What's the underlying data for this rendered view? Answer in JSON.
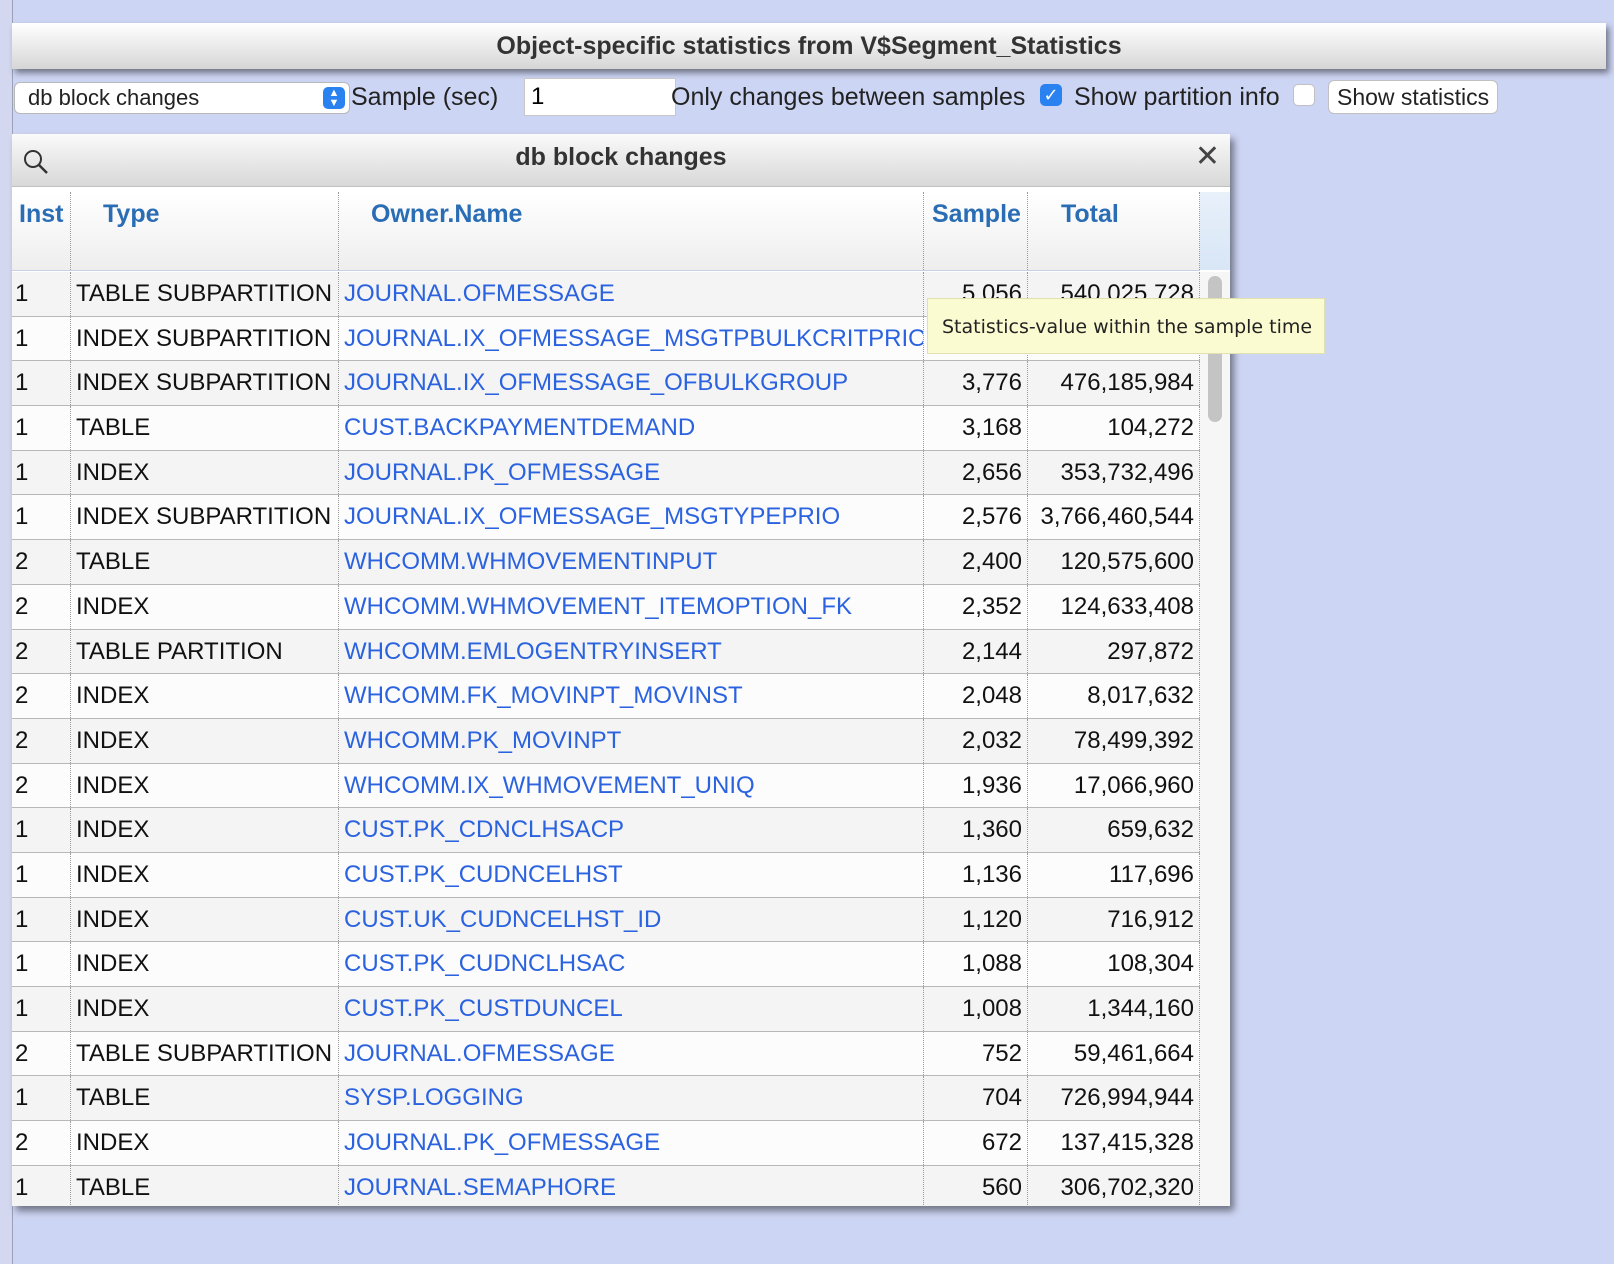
{
  "title": "Object-specific statistics from V$Segment_Statistics",
  "toolbar": {
    "statistic_select": "db block changes",
    "sample_label": "Sample (sec)",
    "sample_value": "1",
    "only_changes_label": "Only changes between samples",
    "only_changes_checked": true,
    "show_partition_label": "Show partition info",
    "show_partition_checked": false,
    "show_statistics_button": "Show statistics"
  },
  "panel": {
    "title": "db block changes",
    "columns": [
      "Inst",
      "Type",
      "Owner.Name",
      "Sample",
      "Total"
    ],
    "rows": [
      [
        "1",
        "TABLE SUBPARTITION",
        "JOURNAL.OFMESSAGE",
        "5,056",
        "540,025,728"
      ],
      [
        "1",
        "INDEX SUBPARTITION",
        "JOURNAL.IX_OFMESSAGE_MSGTPBULKCRITPRIO",
        "",
        ""
      ],
      [
        "1",
        "INDEX SUBPARTITION",
        "JOURNAL.IX_OFMESSAGE_OFBULKGROUP",
        "3,776",
        "476,185,984"
      ],
      [
        "1",
        "TABLE",
        "CUST.BACKPAYMENTDEMAND",
        "3,168",
        "104,272"
      ],
      [
        "1",
        "INDEX",
        "JOURNAL.PK_OFMESSAGE",
        "2,656",
        "353,732,496"
      ],
      [
        "1",
        "INDEX SUBPARTITION",
        "JOURNAL.IX_OFMESSAGE_MSGTYPEPRIO",
        "2,576",
        "3,766,460,544"
      ],
      [
        "2",
        "TABLE",
        "WHCOMM.WHMOVEMENTINPUT",
        "2,400",
        "120,575,600"
      ],
      [
        "2",
        "INDEX",
        "WHCOMM.WHMOVEMENT_ITEMOPTION_FK",
        "2,352",
        "124,633,408"
      ],
      [
        "2",
        "TABLE PARTITION",
        "WHCOMM.EMLOGENTRYINSERT",
        "2,144",
        "297,872"
      ],
      [
        "2",
        "INDEX",
        "WHCOMM.FK_MOVINPT_MOVINST",
        "2,048",
        "8,017,632"
      ],
      [
        "2",
        "INDEX",
        "WHCOMM.PK_MOVINPT",
        "2,032",
        "78,499,392"
      ],
      [
        "2",
        "INDEX",
        "WHCOMM.IX_WHMOVEMENT_UNIQ",
        "1,936",
        "17,066,960"
      ],
      [
        "1",
        "INDEX",
        "CUST.PK_CDNCLHSACP",
        "1,360",
        "659,632"
      ],
      [
        "1",
        "INDEX",
        "CUST.PK_CUDNCELHST",
        "1,136",
        "117,696"
      ],
      [
        "1",
        "INDEX",
        "CUST.UK_CUDNCELHST_ID",
        "1,120",
        "716,912"
      ],
      [
        "1",
        "INDEX",
        "CUST.PK_CUDNCLHSAC",
        "1,088",
        "108,304"
      ],
      [
        "1",
        "INDEX",
        "CUST.PK_CUSTDUNCEL",
        "1,008",
        "1,344,160"
      ],
      [
        "2",
        "TABLE SUBPARTITION",
        "JOURNAL.OFMESSAGE",
        "752",
        "59,461,664"
      ],
      [
        "1",
        "TABLE",
        "SYSP.LOGGING",
        "704",
        "726,994,944"
      ],
      [
        "2",
        "INDEX",
        "JOURNAL.PK_OFMESSAGE",
        "672",
        "137,415,328"
      ],
      [
        "1",
        "TABLE",
        "JOURNAL.SEMAPHORE",
        "560",
        "306,702,320"
      ]
    ]
  },
  "tooltip": "Statistics-value within the sample time",
  "icons": {
    "search": "search-icon",
    "close": "close-icon",
    "select_arrows": "chevron-updown-icon",
    "checkmark": "checkmark-icon"
  },
  "colors": {
    "background": "#cdd5f4",
    "link": "#2a62e0",
    "header_text": "#2a6db5",
    "checkbox_accent": "#2a82f0",
    "tooltip_bg": "#fbfbd2"
  }
}
